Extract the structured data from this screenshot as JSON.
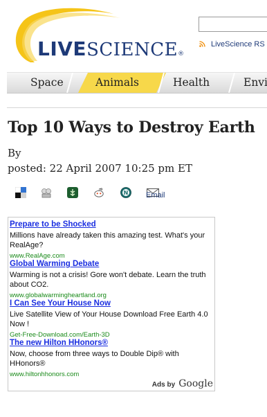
{
  "header": {
    "logo_live": "Live",
    "logo_science": "Science",
    "logo_reg": "®",
    "search_placeholder": "",
    "rss_label": "LiveScience RS"
  },
  "nav": {
    "tabs": [
      {
        "label": "Space",
        "active": false
      },
      {
        "label": "Animals",
        "active": true
      },
      {
        "label": "Health",
        "active": false
      },
      {
        "label": "Envi",
        "active": false
      }
    ]
  },
  "article": {
    "title": "Top 10 Ways to Destroy Earth",
    "byline": "By",
    "posted": "posted: 22 April 2007 10:25 pm ET"
  },
  "tools": {
    "icons": [
      "delicious-icon",
      "digg-icon",
      "newsvine-icon",
      "reddit-icon",
      "netscape-icon",
      "email-icon"
    ],
    "email_label": "Email"
  },
  "ads": {
    "items": [
      {
        "title": "Prepare to be Shocked",
        "desc": "Millions have already taken this amazing test. What's your RealAge?",
        "url": "www.RealAge.com"
      },
      {
        "title": "Global Warming Debate",
        "desc": "Warming is not a crisis! Gore won't debate. Learn the truth about CO2.",
        "url": "www.globalwarmingheartland.org"
      },
      {
        "title": "I Can See Your House Now",
        "desc": "Live Satellite View of Your House Download Free Earth 4.0 Now !",
        "url": "Get-Free-Download.com/Earth-3D"
      },
      {
        "title": "The new Hilton HHonors®",
        "desc": "Now, choose from three ways to Double Dip® with HHonors®",
        "url": "www.hiltonhhonors.com"
      }
    ],
    "ads_by": "Ads by",
    "google": "Google"
  },
  "colors": {
    "brand_blue": "#1e3a78",
    "logo_yellow": "#f5c418",
    "nav_active": "#f7d84a",
    "ad_link": "#1a2ee0",
    "ad_url": "#1a8a1a"
  }
}
